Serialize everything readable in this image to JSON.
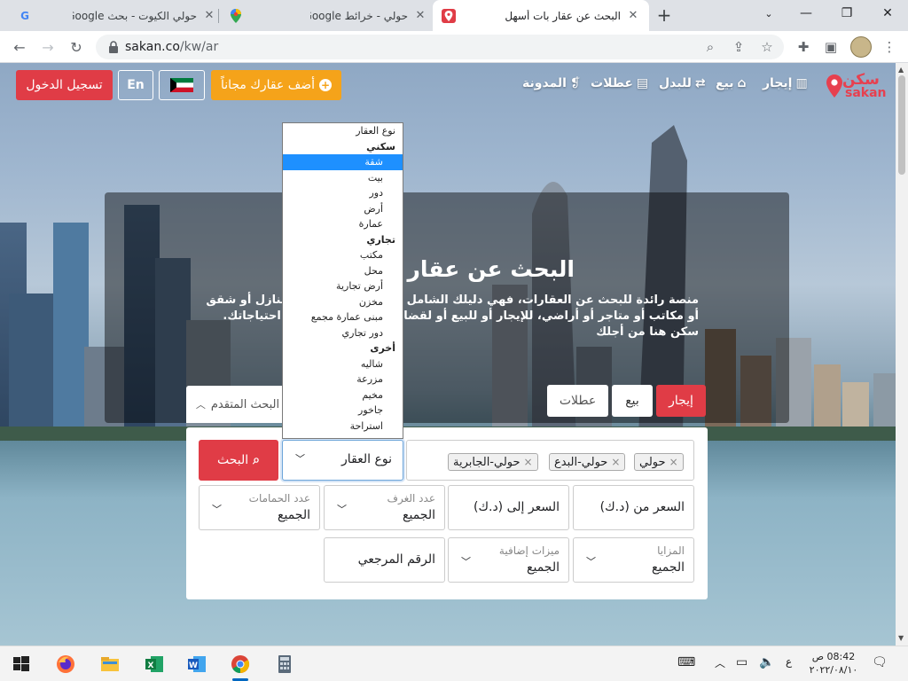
{
  "browser": {
    "tabs": [
      {
        "title": "البحث عن عقار بات أسهل",
        "active": true,
        "favicon": "sakan-pin-icon"
      },
      {
        "title": "حولي - خرائط Google",
        "active": false,
        "favicon": "google-maps-icon"
      },
      {
        "title": "حولي الكيوت - بحث Google",
        "active": false,
        "favicon": "google-g-icon"
      }
    ],
    "url_host": "sakan.co",
    "url_path": "/kw/ar"
  },
  "site": {
    "logo_ar": "سكن",
    "logo_en": "sakan",
    "nav": {
      "rent": "إيجار",
      "sale": "بيع",
      "exchange": "للبدل",
      "holidays": "عطلات",
      "blog": "المدونة"
    },
    "add_property": "أضف عقارك مجاناً",
    "language": "En",
    "login": "تسجيل الدخول",
    "brand_red": "#e03c46",
    "brand_orange": "#f5a31a"
  },
  "hero": {
    "title": "البحث عن عقار بات أسهل",
    "description": "منصة رائدة للبحث عن العقارات، فهي دليلك الشامل ومرشدك للبحث عن منازل أو شقق أو مكاتب أو متاجر أو أراضي، للإيجار أو للبيع أو لقضاء العطلات مهما كانت احتياجاتك. سكن هنا من أجلك"
  },
  "search": {
    "tabs": {
      "rent": "إيجار",
      "sale": "بيع",
      "holidays": "عطلات"
    },
    "advanced": "البحث المتقدم",
    "locations": [
      "حولي",
      "حولي-البدع",
      "حولي-الجابرية"
    ],
    "property_type": "نوع العقار",
    "search_button": "البحث",
    "price_from": "السعر من (د.ك)",
    "price_to": "السعر إلى (د.ك)",
    "rooms_label": "عدد الغرف",
    "rooms_value": "الجميع",
    "baths_label": "عدد الحمامات",
    "baths_value": "الجميع",
    "features_label": "المزايا",
    "features_value": "الجميع",
    "extras_label": "ميزات إضافية",
    "extras_value": "الجميع",
    "reference": "الرقم المرجعي"
  },
  "dropdown": {
    "items": [
      {
        "label": "نوع العقار",
        "kind": "first"
      },
      {
        "label": "سكني",
        "kind": "group"
      },
      {
        "label": "شقة",
        "kind": "selected"
      },
      {
        "label": "بيت",
        "kind": "option"
      },
      {
        "label": "دور",
        "kind": "option"
      },
      {
        "label": "أرض",
        "kind": "option"
      },
      {
        "label": "عمارة",
        "kind": "option"
      },
      {
        "label": "تجاري",
        "kind": "group"
      },
      {
        "label": "مكتب",
        "kind": "option"
      },
      {
        "label": "محل",
        "kind": "option"
      },
      {
        "label": "أرض تجارية",
        "kind": "option"
      },
      {
        "label": "مخزن",
        "kind": "option"
      },
      {
        "label": "مبنى عمارة مجمع",
        "kind": "option"
      },
      {
        "label": "دور تجاري",
        "kind": "option"
      },
      {
        "label": "أخرى",
        "kind": "group"
      },
      {
        "label": "شاليه",
        "kind": "option"
      },
      {
        "label": "مزرعة",
        "kind": "option"
      },
      {
        "label": "مخيم",
        "kind": "option"
      },
      {
        "label": "جاخور",
        "kind": "option"
      },
      {
        "label": "استراحة",
        "kind": "option"
      }
    ]
  },
  "taskbar": {
    "time": "08:42 ص",
    "date": "٢٠٢٢/٠٨/١٠",
    "lang": "ع"
  }
}
